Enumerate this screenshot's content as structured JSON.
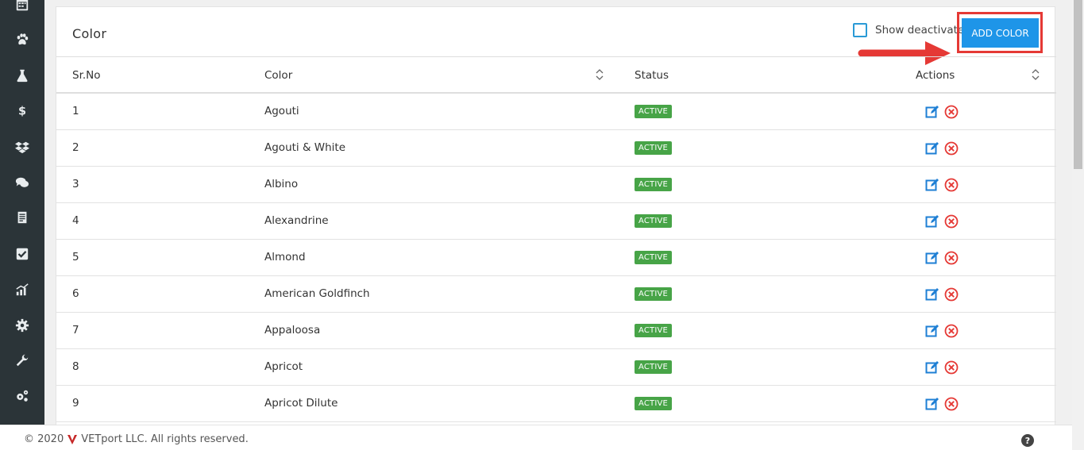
{
  "card": {
    "title": "Color"
  },
  "controls": {
    "show_deactivated_label": "Show deactivated",
    "add_button_label": "ADD COLOR"
  },
  "table": {
    "headers": [
      "Sr.No",
      "Color",
      "Status",
      "Actions"
    ],
    "rows": [
      {
        "srno": "1",
        "color": "Agouti",
        "status": "ACTIVE"
      },
      {
        "srno": "2",
        "color": "Agouti & White",
        "status": "ACTIVE"
      },
      {
        "srno": "3",
        "color": "Albino",
        "status": "ACTIVE"
      },
      {
        "srno": "4",
        "color": "Alexandrine",
        "status": "ACTIVE"
      },
      {
        "srno": "5",
        "color": "Almond",
        "status": "ACTIVE"
      },
      {
        "srno": "6",
        "color": "American Goldfinch",
        "status": "ACTIVE"
      },
      {
        "srno": "7",
        "color": "Appaloosa",
        "status": "ACTIVE"
      },
      {
        "srno": "8",
        "color": "Apricot",
        "status": "ACTIVE"
      },
      {
        "srno": "9",
        "color": "Apricot Dilute",
        "status": "ACTIVE"
      }
    ]
  },
  "sidebar": {
    "icons": [
      "calendar-icon",
      "paw-icon",
      "flask-icon",
      "dollar-icon",
      "dropbox-icon",
      "chat-icon",
      "ledger-icon",
      "checkbox-icon",
      "chart-icon",
      "gear-icon",
      "wrench-icon",
      "gears-icon"
    ]
  },
  "footer": {
    "copyright": "© 2020",
    "company": "VETport LLC. All rights reserved.",
    "help_icon": "?"
  },
  "colors": {
    "accent": "#1e95e8",
    "active_badge": "#47a447",
    "highlight": "#e53935",
    "sidebar": "#2b3438",
    "edit_icon": "#1e7fd4",
    "delete_icon": "#e53935"
  }
}
